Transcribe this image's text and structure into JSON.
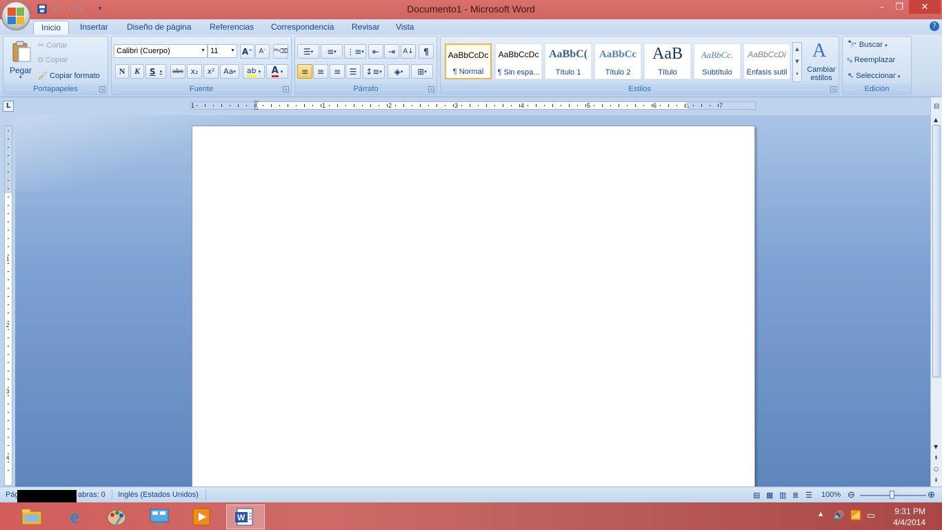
{
  "window": {
    "title": "Documento1 - Microsoft Word"
  },
  "tabs": [
    "Inicio",
    "Insertar",
    "Diseño de página",
    "Referencias",
    "Correspondencia",
    "Revisar",
    "Vista"
  ],
  "clipboard": {
    "paste": "Pegar",
    "cut": "Cortar",
    "copy": "Copiar",
    "format_painter": "Copiar formato",
    "label": "Portapapeles"
  },
  "font": {
    "name": "Calibri (Cuerpo)",
    "size": "11",
    "label": "Fuente",
    "bold": "N",
    "italic": "K",
    "underline": "S",
    "strike": "abc",
    "sub": "x₂",
    "sup": "x²",
    "case": "Aa",
    "grow": "A",
    "shrink": "A"
  },
  "paragraph": {
    "label": "Párrafo",
    "pilcrow": "¶"
  },
  "styles": {
    "label": "Estilos",
    "items": [
      {
        "sample": "AaBbCcDc",
        "name": "¶ Normal"
      },
      {
        "sample": "AaBbCcDc",
        "name": "¶ Sin espa..."
      },
      {
        "sample": "AaBbC(",
        "name": "Título 1"
      },
      {
        "sample": "AaBbCc",
        "name": "Título 2"
      },
      {
        "sample": "AaB",
        "name": "Título"
      },
      {
        "sample": "AaBbCc.",
        "name": "Subtítulo"
      },
      {
        "sample": "AaBbCcDi",
        "name": "Énfasis sutil"
      }
    ],
    "change": "Cambiar estilos"
  },
  "editing": {
    "label": "Edición",
    "find": "Buscar",
    "replace": "Reemplazar",
    "select": "Seleccionar"
  },
  "ruler": {
    "numbers": [
      "1",
      "1",
      "2",
      "3",
      "4",
      "5",
      "6",
      "7"
    ],
    "vnumbers": [
      "1",
      "2",
      "3",
      "4"
    ],
    "tab_selector": "L"
  },
  "status": {
    "page": "Pág",
    "words": "abras: 0",
    "language": "Inglés (Estados Unidos)",
    "zoom": "100%"
  },
  "taskbar": {
    "time": "9:31 PM",
    "date": "4/4/2014"
  },
  "colors": {
    "accent": "#15428b",
    "title_bar": "#d26b67",
    "ribbon": "#c8dbee",
    "workspace": "#7ea2d2"
  }
}
